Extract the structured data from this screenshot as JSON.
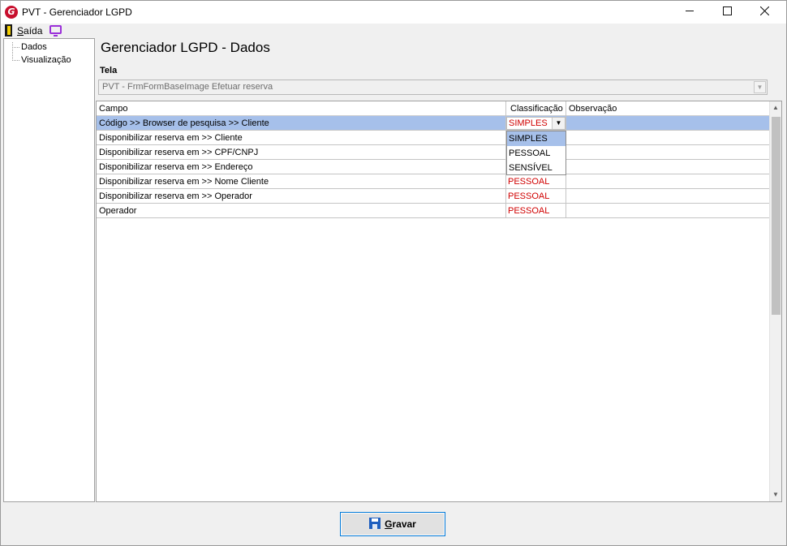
{
  "window": {
    "title": "PVT - Gerenciador LGPD",
    "logo_letter": "G"
  },
  "titlebar_icons": {
    "minimize": "minimize-icon",
    "maximize": "maximize-icon",
    "close": "close-icon"
  },
  "menu": {
    "saida_first": "S",
    "saida_rest": "aída",
    "monitor_icon": "monitor-icon"
  },
  "tree": {
    "items": [
      "Dados",
      "Visualização"
    ]
  },
  "page": {
    "title": "Gerenciador LGPD - Dados"
  },
  "tela": {
    "label": "Tela",
    "value": "PVT - FrmFormBaseImage Efetuar reserva"
  },
  "grid": {
    "headers": [
      "Campo",
      "Classificação",
      "Observação"
    ],
    "rows": [
      {
        "campo": "Código >> Browser de pesquisa >> Cliente",
        "classificacao": "SIMPLES",
        "observacao": ""
      },
      {
        "campo": "Disponibilizar reserva em >> Cliente",
        "classificacao": "",
        "observacao": ""
      },
      {
        "campo": "Disponibilizar reserva em >> CPF/CNPJ",
        "classificacao": "",
        "observacao": ""
      },
      {
        "campo": "Disponibilizar reserva em >> Endereço",
        "classificacao": "",
        "observacao": ""
      },
      {
        "campo": "Disponibilizar reserva em >> Nome Cliente",
        "classificacao": "PESSOAL",
        "observacao": ""
      },
      {
        "campo": "Disponibilizar reserva em >> Operador",
        "classificacao": "PESSOAL",
        "observacao": ""
      },
      {
        "campo": "Operador",
        "classificacao": "PESSOAL",
        "observacao": ""
      }
    ],
    "selected_row": 0,
    "dropdown_options": [
      "SIMPLES",
      "PESSOAL",
      "SENSÍVEL"
    ],
    "dropdown_highlighted": "SIMPLES"
  },
  "colors": {
    "classification_text": "#d00000",
    "selection": "#a6c0ea",
    "button_border": "#0078d7"
  },
  "footer": {
    "gravar_first": "G",
    "gravar_rest": "ravar"
  }
}
